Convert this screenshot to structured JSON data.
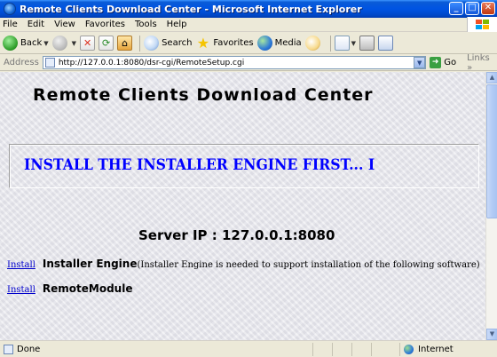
{
  "window": {
    "title": "Remote Clients Download Center - Microsoft Internet Explorer",
    "buttons": [
      "_",
      "□",
      "✕"
    ]
  },
  "menu": [
    "File",
    "Edit",
    "View",
    "Favorites",
    "Tools",
    "Help"
  ],
  "toolbar": {
    "back_label": "Back",
    "search_label": "Search",
    "favorites_label": "Favorites",
    "media_label": "Media"
  },
  "address": {
    "label": "Address",
    "url": "http://127.0.0.1:8080/dsr-cgi/RemoteSetup.cgi",
    "go_label": "Go",
    "links_label": "Links"
  },
  "page": {
    "heading": "Remote Clients Download Center",
    "banner": "INSTALL THE INSTALLER ENGINE FIRST...   I",
    "server_ip": "Server IP : 127.0.0.1:8080",
    "items": [
      {
        "link": "Install",
        "name": "Installer Engine",
        "note": "(Installer Engine is needed to support installation of the following software)"
      },
      {
        "link": "Install",
        "name": "RemoteModule",
        "note": ""
      }
    ]
  },
  "status": {
    "text": "Done",
    "zone": "Internet"
  },
  "colors": {
    "banner_text": "#0000ff",
    "link": "#0000cc",
    "titlebar": "#0054e3"
  }
}
